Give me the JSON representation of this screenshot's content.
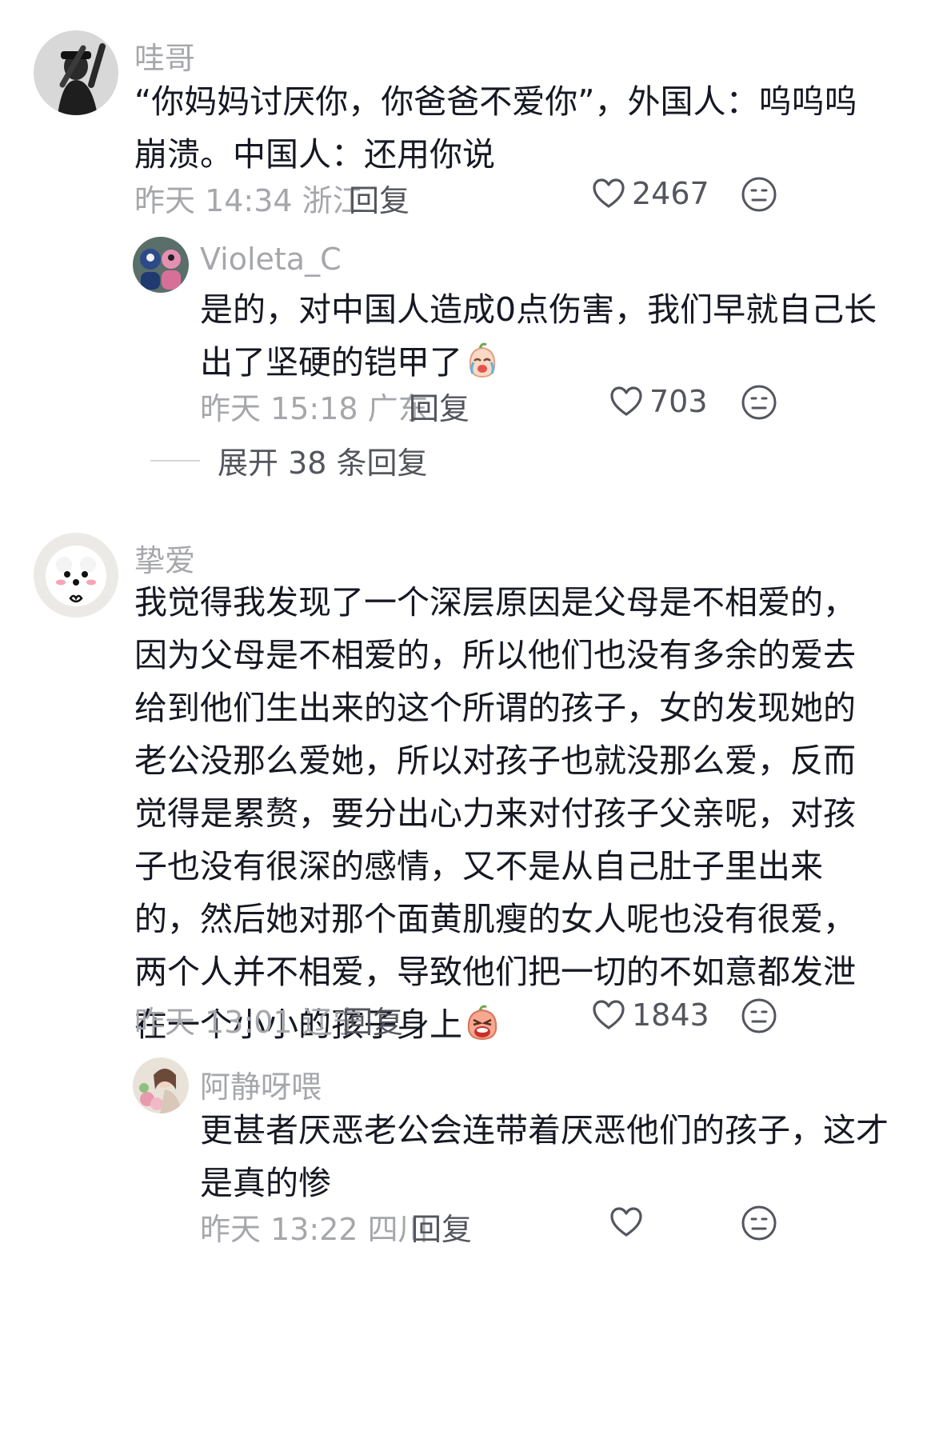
{
  "comments": [
    {
      "name": "哇哥",
      "text": "“你妈妈讨厌你，你爸爸不爱你”，外国人：呜呜呜崩溃。中国人：还用你说",
      "time": "昨天 14:34 浙江",
      "reply": "回复",
      "likes": "2467",
      "avatar_icon": "user-avatar-hat"
    },
    {
      "name": "Violeta_C",
      "text": "是的，对中国人造成0点伤害，我们早就自己长出了坚硬的铠甲了",
      "emoji": "crying-face-emoji",
      "time": "昨天 15:18 广东",
      "reply": "回复",
      "likes": "703",
      "avatar_icon": "user-avatar-dolls"
    },
    {
      "name": "挚爱",
      "text": "我觉得我发现了一个深层原因是父母是不相爱的，因为父母是不相爱的，所以他们也没有多余的爱去给到他们生出来的这个所谓的孩子，女的发现她的老公没那么爱她，所以对孩子也就没那么爱，反而觉得是累赘，要分出心力来对付孩子父亲呢，对孩子也没有很深的感情，又不是从自己肚子里出来的，然后她对那个面黄肌瘦的女人呢也没有很爱，两个人并不相爱，导致他们把一切的不如意都发泄在一个小小的孩子身上",
      "emoji": "wailing-face-emoji",
      "time": "昨天 13:01 辽宁",
      "reply": "回复",
      "likes": "1843",
      "avatar_icon": "user-avatar-dog"
    },
    {
      "name": "阿静呀喂",
      "text": "更甚者厌恶老公会连带着厌恶他们的孩子，这才是真的惨",
      "time": "昨天 13:22 四川",
      "reply": "回复",
      "likes": "",
      "avatar_icon": "user-avatar-flowers"
    }
  ],
  "expand_replies": "展开 38 条回复",
  "colors": {
    "secondary_text": "#a6a7ab",
    "primary_text": "#161823",
    "action_text": "#54565e"
  }
}
